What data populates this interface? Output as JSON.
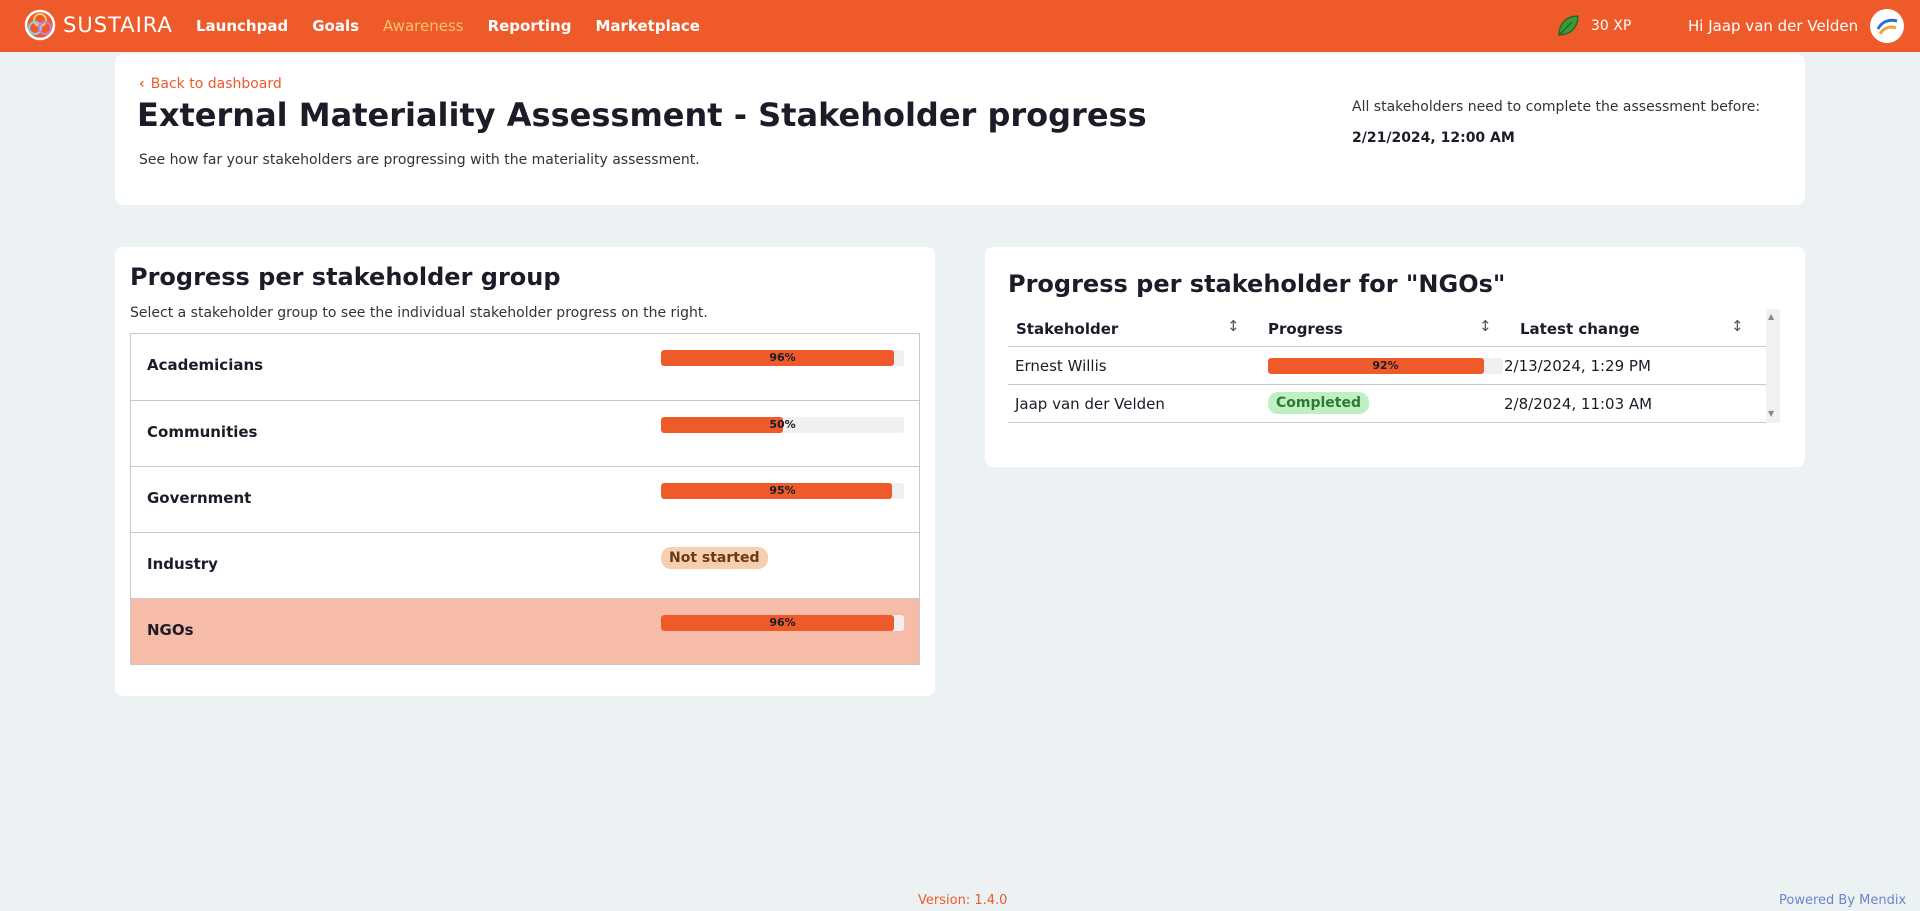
{
  "app": {
    "brand": "SUSTAIRA",
    "nav": [
      {
        "label": "Launchpad",
        "active": false
      },
      {
        "label": "Goals",
        "active": false
      },
      {
        "label": "Awareness",
        "active": true
      },
      {
        "label": "Reporting",
        "active": false
      },
      {
        "label": "Marketplace",
        "active": false
      }
    ],
    "xp": "30 XP",
    "greeting": "Hi Jaap van der Velden",
    "colors": {
      "accent": "#ee5a2a",
      "active_nav": "#f9c46b",
      "selected_row": "#f7bca8"
    }
  },
  "header": {
    "back_label": "Back to dashboard",
    "title": "External Materiality Assessment - Stakeholder progress",
    "subtitle": "See how far your stakeholders are progressing with the materiality assessment.",
    "deadline_label": "All stakeholders need to complete the assessment before:",
    "deadline_value": "2/21/2024, 12:00 AM"
  },
  "groups_panel": {
    "title": "Progress per stakeholder group",
    "subtitle": "Select a stakeholder group to see the individual stakeholder progress on the right.",
    "groups": [
      {
        "name": "Academicians",
        "progress": 96,
        "label": "96%",
        "status": "progress",
        "selected": false
      },
      {
        "name": "Communities",
        "progress": 50,
        "label": "50%",
        "status": "progress",
        "selected": false
      },
      {
        "name": "Government",
        "progress": 95,
        "label": "95%",
        "status": "progress",
        "selected": false
      },
      {
        "name": "Industry",
        "progress": 0,
        "label": "Not started",
        "status": "not-started",
        "selected": false
      },
      {
        "name": "NGOs",
        "progress": 96,
        "label": "96%",
        "status": "progress",
        "selected": true
      }
    ]
  },
  "stakeholders_panel": {
    "title": "Progress per stakeholder for \"NGOs\"",
    "columns": [
      "Stakeholder",
      "Progress",
      "Latest change"
    ],
    "rows": [
      {
        "stakeholder": "Ernest Willis",
        "progress": 92,
        "label": "92%",
        "status": "progress",
        "latest_change": "2/13/2024, 1:29 PM"
      },
      {
        "stakeholder": "Jaap van der Velden",
        "progress": 100,
        "label": "Completed",
        "status": "completed",
        "latest_change": "2/8/2024, 11:03 AM"
      }
    ]
  },
  "footer": {
    "version": "Version: 1.4.0",
    "powered_by": "Powered By Mendix"
  }
}
